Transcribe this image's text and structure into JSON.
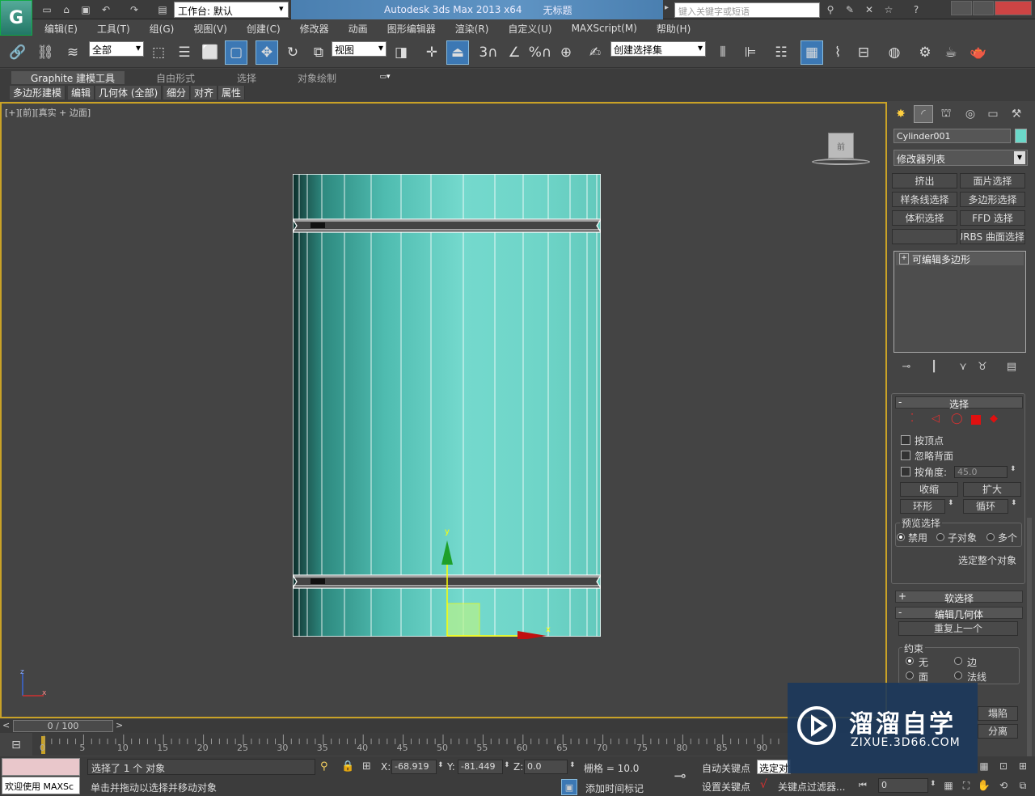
{
  "titlebar": {
    "workspace_label": "工作台: 默认",
    "app_title": "Autodesk 3ds Max  2013 x64",
    "doc_title": "无标题",
    "search_placeholder": "键入关键字或短语"
  },
  "menu": [
    "编辑(E)",
    "工具(T)",
    "组(G)",
    "视图(V)",
    "创建(C)",
    "修改器",
    "动画",
    "图形编辑器",
    "渲染(R)",
    "自定义(U)",
    "MAXScript(M)",
    "帮助(H)"
  ],
  "toolbar": {
    "selection_filter": "全部",
    "ref_coord": "视图",
    "named_selection": "创建选择集",
    "snap_label": "3",
    "percent_label": "%"
  },
  "ribbon": {
    "tabs": [
      "Graphite 建模工具",
      "自由形式",
      "选择",
      "对象绘制"
    ],
    "subtabs": [
      "多边形建模",
      "编辑",
      "几何体 (全部)",
      "细分",
      "对齐",
      "属性"
    ]
  },
  "viewport": {
    "label": "[+][前][真实 + 边面]",
    "navcube_label": "前",
    "axis_y": "y",
    "axis_x": "x",
    "axis_z": "z"
  },
  "panel": {
    "object_name": "Cylinder001",
    "object_color": "#6bd8c9",
    "modifier_list": "修改器列表",
    "mod_buttons": [
      "挤出",
      "面片选择",
      "样条线选择",
      "多边形选择",
      "体积选择",
      "FFD 选择",
      "",
      "NURBS 曲面选择"
    ],
    "stack_item": "可编辑多边形",
    "selection_rollout": "选择",
    "by_vertex": "按顶点",
    "ignore_backface": "忽略背面",
    "by_angle": "按角度:",
    "angle_value": "45.0",
    "shrink": "收缩",
    "grow": "扩大",
    "ring": "环形",
    "loop": "循环",
    "preview_title": "预览选择",
    "preview_opts": [
      "禁用",
      "子对象",
      "多个"
    ],
    "select_whole": "选定整个对象",
    "soft_selection": "软选择",
    "edit_geometry": "编辑几何体",
    "repeat_last": "重复上一个",
    "constraint_title": "约束",
    "constraint_opts": [
      "无",
      "边",
      "面",
      "法线"
    ],
    "collapse": "塌陷",
    "separate": "分离"
  },
  "timeline": {
    "position": "0 / 100",
    "ticks": [
      "0",
      "5",
      "10",
      "15",
      "20",
      "25",
      "30",
      "35",
      "40",
      "45",
      "50",
      "55",
      "60",
      "65",
      "70",
      "75",
      "80",
      "85",
      "90"
    ]
  },
  "status": {
    "welcome": "欢迎使用 MAXSc",
    "selected": "选择了 1 个 对象",
    "prompt": "单击并拖动以选择并移动对象",
    "x_label": "X:",
    "x_value": "-68.919",
    "y_label": "Y:",
    "y_value": "-81.449",
    "z_label": "Z:",
    "z_value": "0.0",
    "grid": "栅格 = 10.0",
    "auto_key": "自动关键点",
    "set_key": "设置关键点",
    "selected_set": "选定对象",
    "key_filters": "关键点过滤器...",
    "add_time_tag": "添加时间标记",
    "frame_value": "0"
  },
  "watermark": {
    "title": "溜溜自学",
    "url": "ZIXUE.3D66.COM"
  }
}
